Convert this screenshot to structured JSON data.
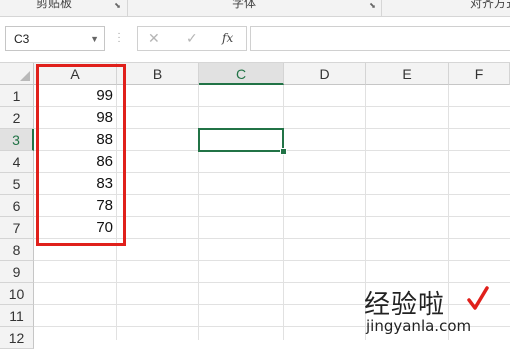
{
  "ribbon": {
    "groups": [
      "剪贴板",
      "字体",
      "对齐方式"
    ]
  },
  "formula_bar": {
    "name_box": "C3",
    "cancel_icon": "✕",
    "enter_icon": "✓",
    "fx_label": "fx",
    "formula_value": ""
  },
  "sheet": {
    "columns": [
      "A",
      "B",
      "C",
      "D",
      "E",
      "F"
    ],
    "rows": [
      "1",
      "2",
      "3",
      "4",
      "5",
      "6",
      "7",
      "8",
      "9",
      "10",
      "11",
      "12"
    ],
    "active_cell": "C3",
    "column_a_values": [
      "99",
      "98",
      "88",
      "86",
      "83",
      "78",
      "70"
    ]
  },
  "watermark": {
    "text": "经验啦",
    "url": "jingyanla.com",
    "check_color": "#e0201b"
  },
  "colors": {
    "accent": "#217346",
    "highlight_box": "#e0201b"
  }
}
